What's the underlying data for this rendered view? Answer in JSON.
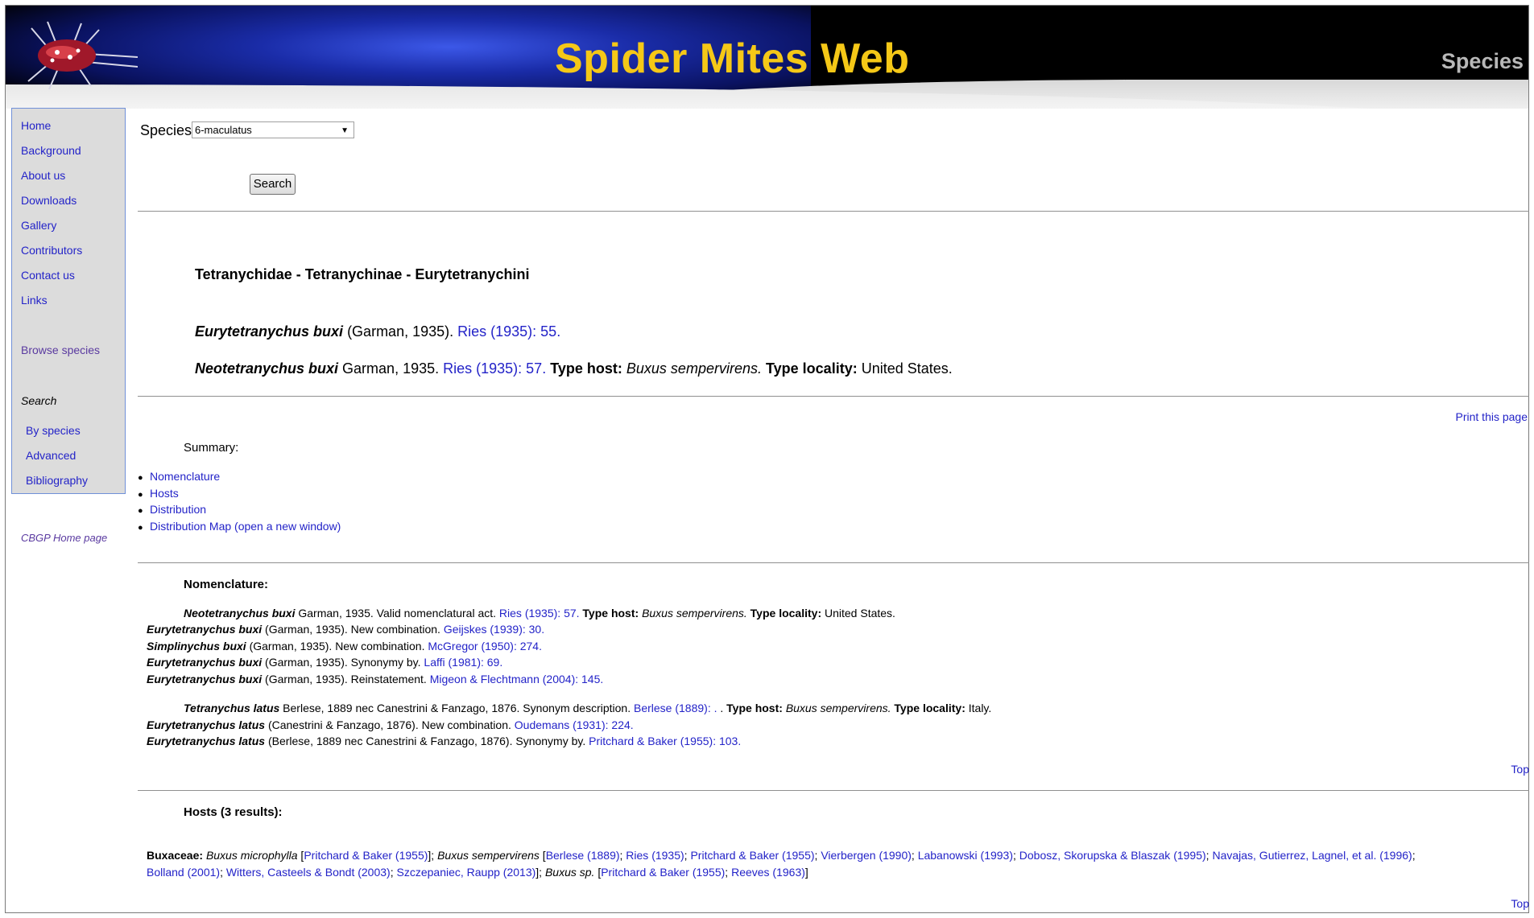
{
  "header": {
    "site_title": "Spider Mites Web",
    "section_label": "Species"
  },
  "sidebar": {
    "items": [
      "Home",
      "Background",
      "About us",
      "Downloads",
      "Gallery",
      "Contributors",
      "Contact us",
      "Links"
    ],
    "browse": "Browse species",
    "search_heading": "Search",
    "search_items": [
      "By species",
      "Advanced",
      "Bibliography"
    ],
    "cbgp": "CBGP Home page"
  },
  "search_form": {
    "species_label": "Species",
    "species_value": "6-maculatus",
    "search_button": "Search"
  },
  "taxonomy": "Tetranychidae - Tetranychinae - Eurytetranychini",
  "species": [
    {
      "name": "Eurytetranychus buxi",
      "author": " (Garman, 1935). ",
      "ref": "Ries (1935): 55."
    },
    {
      "name": "Neotetranychus buxi",
      "author": " Garman, 1935. ",
      "ref": "Ries (1935): 57.",
      "host_label": "Type host:",
      "host": "Buxus sempervirens.",
      "loc_label": "Type locality:",
      "loc": "United States."
    }
  ],
  "print_label": "Print this page",
  "summary": {
    "label": "Summary:",
    "items": [
      "Nomenclature",
      "Hosts",
      "Distribution",
      "Distribution Map (open a new window)"
    ]
  },
  "nomenclature": {
    "title": "Nomenclature:",
    "group1": [
      {
        "name": "Neotetranychus buxi",
        "text": " Garman, 1935. Valid nomenclatural act. ",
        "ref": "Ries (1935): 57.",
        "host_label": "Type host:",
        "host": "Buxus sempervirens.",
        "loc_label": "Type locality:",
        "loc": "United States."
      },
      {
        "name": "Eurytetranychus buxi",
        "text": " (Garman, 1935). New combination. ",
        "ref": "Geijskes (1939): 30."
      },
      {
        "name": "Simplinychus buxi",
        "text": " (Garman, 1935). New combination. ",
        "ref": "McGregor (1950): 274."
      },
      {
        "name": "Eurytetranychus buxi",
        "text": " (Garman, 1935). Synonymy by. ",
        "ref": "Laffi (1981): 69."
      },
      {
        "name": "Eurytetranychus buxi",
        "text": " (Garman, 1935). Reinstatement. ",
        "ref": "Migeon & Flechtmann (2004): 145."
      }
    ],
    "group2": [
      {
        "name": "Tetranychus latus",
        "text": " Berlese, 1889 nec Canestrini & Fanzago, 1876. Synonym description. ",
        "ref": "Berlese (1889): .",
        "tail": " . ",
        "host_label": "Type host:",
        "host": "Buxus sempervirens.",
        "loc_label": "Type locality:",
        "loc": "Italy."
      },
      {
        "name": "Eurytetranychus latus",
        "text": " (Canestrini & Fanzago, 1876). New combination. ",
        "ref": "Oudemans (1931): 224."
      },
      {
        "name": "Eurytetranychus latus",
        "text": " (Berlese, 1889 nec Canestrini & Fanzago, 1876). Synonymy by. ",
        "ref": "Pritchard & Baker (1955): 103."
      }
    ],
    "top": "Top"
  },
  "hosts": {
    "title": "Hosts (3 results):",
    "family": "Buxaceae:",
    "sp1": "Buxus microphylla",
    "sp1_refs": [
      "Pritchard & Baker (1955)"
    ],
    "sp2": "Buxus sempervirens",
    "sp2_refs_line1": [
      "Berlese (1889)",
      "Ries (1935)",
      "Pritchard & Baker (1955)",
      "Vierbergen (1990)",
      "Labanowski (1993)",
      "Dobosz, Skorupska & Blaszak (1995)",
      "Navajas, Gutierrez, Lagnel, et al. (1996)"
    ],
    "sp2_refs_line2": [
      "Bolland (2001)",
      "Witters, Casteels & Bondt (2003)",
      "Szczepaniec, Raupp (2013)"
    ],
    "sp3": "Buxus sp.",
    "sp3_refs": [
      "Pritchard & Baker (1955)",
      "Reeves (1963)"
    ],
    "top": "Top"
  }
}
